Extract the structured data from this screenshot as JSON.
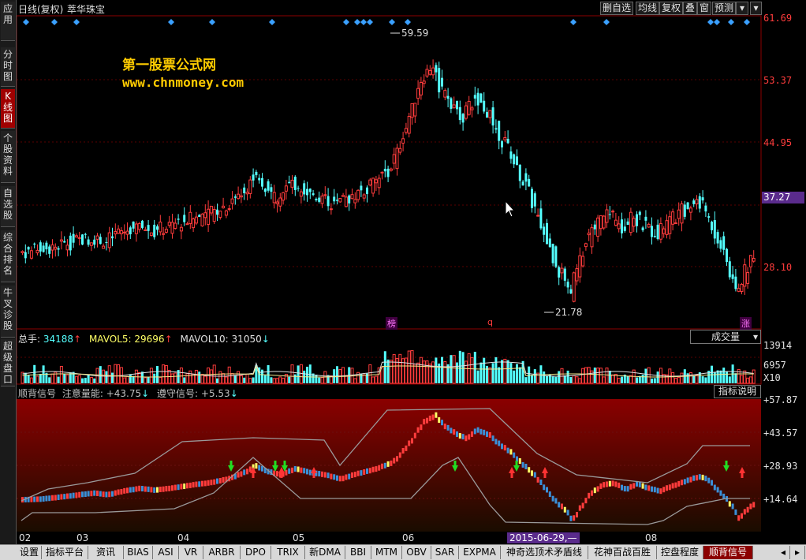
{
  "sidebar": {
    "tabs": [
      {
        "label": "应用"
      },
      {
        "label": "分时图"
      },
      {
        "label": "K线图",
        "active": true
      },
      {
        "label": "个股资料"
      },
      {
        "label": "自选股"
      },
      {
        "label": "综合排名"
      },
      {
        "label": "牛叉诊股"
      },
      {
        "label": "超级盘口"
      }
    ]
  },
  "header": {
    "period": "日线(复权)",
    "stock_name": "萃华珠宝",
    "buttons": [
      "删自选",
      "均线",
      "复权",
      "叠",
      "窗",
      "预测"
    ]
  },
  "watermark": {
    "line1": "第一股票公式网",
    "line2": "www.chnmoney.com"
  },
  "price_axis": {
    "labels": [
      "61.69",
      "53.37",
      "44.95",
      "28.10"
    ],
    "current_price": "37.27",
    "high_label": "59.59",
    "low_label": "21.78"
  },
  "markers": {
    "m1": "榜",
    "m2": "q",
    "m3": "涨"
  },
  "volume": {
    "label": "总手:",
    "value": "34188",
    "mavol5_label": "MAVOL5:",
    "mavol5_value": "29696",
    "mavol10_label": "MAVOL10:",
    "mavol10_value": "31050",
    "dropdown": "成交量",
    "axis": [
      "13914",
      "6957"
    ],
    "unit": "X10"
  },
  "indicator": {
    "name": "顺背信号",
    "label1": "注意量能:",
    "value1": "+43.75",
    "label2": "遵守信号:",
    "value2": "+5.53",
    "help_button": "指标说明",
    "axis": [
      "+57.87",
      "+43.57",
      "+28.93",
      "+14.64"
    ],
    "date_highlight": "2015-06-29,—"
  },
  "x_labels": [
    "02",
    "03",
    "04",
    "05",
    "06",
    "08"
  ],
  "bottom_tabs": [
    "设置",
    "指标平台",
    "资讯",
    "BIAS",
    "ASI",
    "VR",
    "ARBR",
    "DPO",
    "TRIX",
    "新DMA",
    "BBI",
    "MTM",
    "OBV",
    "SAR",
    "EXPMA",
    "神奇选顶术矛盾线",
    "花神百战百胜",
    "控盘程度",
    "顺背信号"
  ],
  "active_bottom_tab": "顺背信号",
  "colors": {
    "up": "#ff3c3c",
    "down": "#54ffff",
    "accent": "#ffcc00",
    "indicator_bg_top": "#8b0000"
  },
  "chart_data": {
    "type": "candlestick",
    "title": "萃华珠宝",
    "high": 59.59,
    "low": 21.78,
    "x_ticks": [
      "02",
      "03",
      "04",
      "05",
      "06",
      "08"
    ],
    "price_ticks": [
      61.69,
      53.37,
      44.95,
      28.1
    ],
    "current": 37.27
  }
}
